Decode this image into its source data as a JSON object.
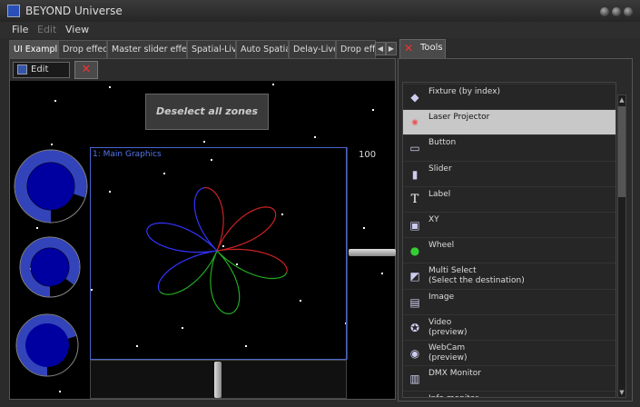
{
  "window": {
    "title": "BEYOND Universe"
  },
  "menu": [
    "File",
    "Edit",
    "View"
  ],
  "tabs": [
    "UI Example",
    "Drop effect",
    "Master slider effects",
    "Spatial-Live",
    "Auto Spatial",
    "Delay-Live",
    "Drop effe"
  ],
  "toolbar": {
    "edit_label": "Edit"
  },
  "main": {
    "deselect_label": "Deselect all zones",
    "graphics_label": "1: Main Graphics",
    "slider_value": "100"
  },
  "tools": {
    "tab_label": "Tools",
    "items": [
      {
        "label": "Fixture (by index)",
        "icon": "fixture-icon"
      },
      {
        "label": "Laser Projector",
        "icon": "laser-projector-icon",
        "selected": true
      },
      {
        "label": "Button",
        "icon": "button-icon"
      },
      {
        "label": "Slider",
        "icon": "slider-icon"
      },
      {
        "label": "Label",
        "icon": "label-icon"
      },
      {
        "label": "XY",
        "icon": "xy-icon"
      },
      {
        "label": "Wheel",
        "icon": "wheel-icon"
      },
      {
        "label": "Multi Select\n(Select the destination)",
        "icon": "multi-select-icon"
      },
      {
        "label": "Image",
        "icon": "image-icon"
      },
      {
        "label": "Video\n(preview)",
        "icon": "video-icon"
      },
      {
        "label": "WebCam\n(preview)",
        "icon": "webcam-icon"
      },
      {
        "label": "DMX Monitor",
        "icon": "dmx-monitor-icon"
      },
      {
        "label": "Info monitor",
        "icon": "info-monitor-icon"
      }
    ]
  },
  "wheels": [
    {
      "name": "wheel-1",
      "level": 0.8
    },
    {
      "name": "wheel-2",
      "level": 0.85
    },
    {
      "name": "wheel-3",
      "level": 0.7
    }
  ],
  "colors": {
    "accent": "#4a66cc",
    "selection": "#c8c8c8",
    "wheel_fill": "#0000a0",
    "ring": "#3344bb"
  }
}
